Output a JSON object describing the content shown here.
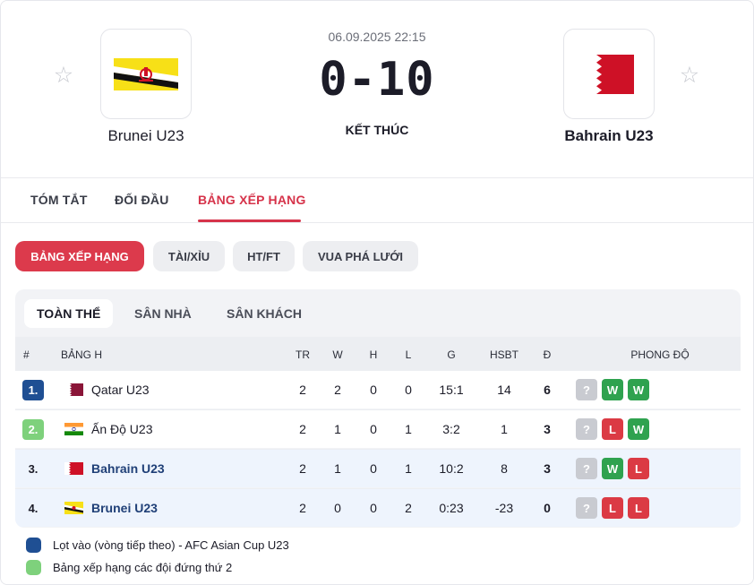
{
  "match": {
    "datetime": "06.09.2025 22:15",
    "score": "0-10",
    "status": "KẾT THÚC",
    "home": {
      "name": "Brunei U23",
      "flag_icon": "brunei-flag-icon"
    },
    "away": {
      "name": "Bahrain U23",
      "flag_icon": "bahrain-flag-icon"
    }
  },
  "tabs": [
    {
      "label": "TÓM TẮT"
    },
    {
      "label": "ĐỐI ĐẦU"
    },
    {
      "label": "BẢNG XẾP HẠNG",
      "active": true
    }
  ],
  "filters": [
    {
      "label": "BẢNG XẾP HẠNG",
      "active": true
    },
    {
      "label": "TÀI/XỈU"
    },
    {
      "label": "HT/FT"
    },
    {
      "label": "VUA PHÁ LƯỚI"
    }
  ],
  "subtabs": [
    {
      "label": "TOÀN THỂ",
      "active": true
    },
    {
      "label": "SÂN NHÀ"
    },
    {
      "label": "SÂN KHÁCH"
    }
  ],
  "table": {
    "headers": {
      "rank": "#",
      "group": "BẢNG H",
      "tr": "TR",
      "w": "W",
      "h": "H",
      "l": "L",
      "g": "G",
      "hsbt": "HSBT",
      "d": "Đ",
      "form": "PHONG ĐỘ"
    },
    "rows": [
      {
        "rank": "1.",
        "team": "Qatar U23",
        "tr": "2",
        "w": "2",
        "h": "0",
        "l": "0",
        "g": "15:1",
        "hsbt": "14",
        "d": "6",
        "form": [
          "?",
          "W",
          "W"
        ]
      },
      {
        "rank": "2.",
        "team": "Ấn Độ U23",
        "tr": "2",
        "w": "1",
        "h": "0",
        "l": "1",
        "g": "3:2",
        "hsbt": "1",
        "d": "3",
        "form": [
          "?",
          "L",
          "W"
        ]
      },
      {
        "rank": "3.",
        "team": "Bahrain U23",
        "tr": "2",
        "w": "1",
        "h": "0",
        "l": "1",
        "g": "10:2",
        "hsbt": "8",
        "d": "3",
        "form": [
          "?",
          "W",
          "L"
        ]
      },
      {
        "rank": "4.",
        "team": "Brunei U23",
        "tr": "2",
        "w": "0",
        "h": "0",
        "l": "2",
        "g": "0:23",
        "hsbt": "-23",
        "d": "0",
        "form": [
          "?",
          "L",
          "L"
        ]
      }
    ]
  },
  "legend": [
    {
      "text": "Lọt vào (vòng tiếp theo) - AFC Asian Cup U23",
      "color": "#1f4f93"
    },
    {
      "text": "Bảng xếp hạng các đội đứng thứ 2",
      "color": "#7ed17c"
    }
  ],
  "colors": {
    "accent": "#dc3a4c",
    "qualify": "#1f4f93",
    "second": "#7ed17c",
    "win": "#2fa24f",
    "loss": "#db3a44",
    "unknown": "#c9cbd1"
  }
}
